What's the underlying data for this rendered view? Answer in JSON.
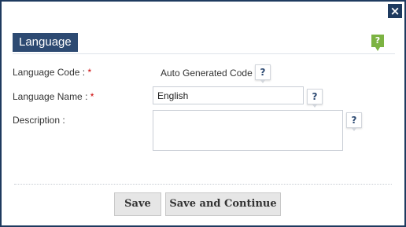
{
  "dialog": {
    "close_icon": "×",
    "title": "Language",
    "title_help_icon": "?"
  },
  "form": {
    "code": {
      "label": "Language Code :",
      "required": "*",
      "value": "Auto Generated Code",
      "help": "?"
    },
    "name": {
      "label": "Language Name :",
      "required": "*",
      "value": "English",
      "help": "?"
    },
    "description": {
      "label": "Description :",
      "value": "",
      "help": "?"
    }
  },
  "buttons": {
    "save": "Save",
    "save_continue": "Save and Continue"
  },
  "colors": {
    "header": "#2d4a72",
    "border": "#1e3a5f",
    "help_green": "#7cb342",
    "required": "#cc0000"
  }
}
